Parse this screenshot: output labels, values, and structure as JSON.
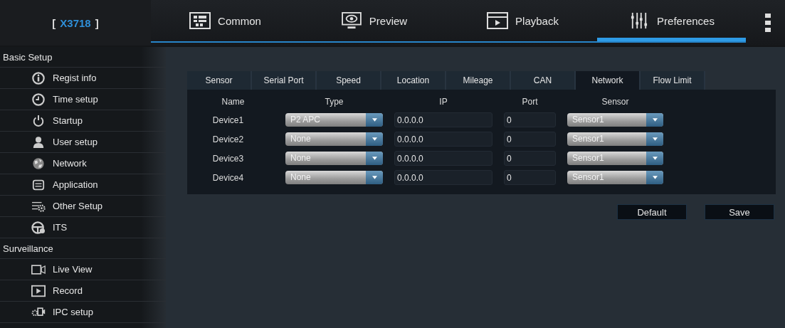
{
  "header": {
    "bracket_open": "[",
    "device": "X3718",
    "bracket_close": "]",
    "nav": [
      {
        "label": "Common",
        "selected": false
      },
      {
        "label": "Preview",
        "selected": false
      },
      {
        "label": "Playback",
        "selected": false
      },
      {
        "label": "Preferences",
        "selected": true
      }
    ]
  },
  "sidebar": [
    {
      "kind": "section",
      "label": "Basic Setup"
    },
    {
      "kind": "item",
      "label": "Regist info"
    },
    {
      "kind": "item",
      "label": "Time setup"
    },
    {
      "kind": "item",
      "label": "Startup"
    },
    {
      "kind": "item",
      "label": "User setup"
    },
    {
      "kind": "item",
      "label": "Network"
    },
    {
      "kind": "item",
      "label": "Application"
    },
    {
      "kind": "item",
      "label": "Other Setup"
    },
    {
      "kind": "item",
      "label": "ITS"
    },
    {
      "kind": "section",
      "label": "Surveillance"
    },
    {
      "kind": "item",
      "label": "Live View"
    },
    {
      "kind": "item",
      "label": "Record"
    },
    {
      "kind": "item",
      "label": "IPC setup"
    }
  ],
  "tabs": [
    {
      "label": "Sensor",
      "selected": false
    },
    {
      "label": "Serial Port",
      "selected": false
    },
    {
      "label": "Speed",
      "selected": false
    },
    {
      "label": "Location",
      "selected": false
    },
    {
      "label": "Mileage",
      "selected": false
    },
    {
      "label": "CAN",
      "selected": false
    },
    {
      "label": "Network",
      "selected": true
    },
    {
      "label": "Flow Limit",
      "selected": false
    }
  ],
  "table": {
    "columns": [
      "Name",
      "Type",
      "IP",
      "Port",
      "Sensor"
    ],
    "rows": [
      {
        "name": "Device1",
        "type": "P2 APC",
        "ip": "0.0.0.0",
        "port": "0",
        "sensor": "Sensor1"
      },
      {
        "name": "Device2",
        "type": "None",
        "ip": "0.0.0.0",
        "port": "0",
        "sensor": "Sensor1"
      },
      {
        "name": "Device3",
        "type": "None",
        "ip": "0.0.0.0",
        "port": "0",
        "sensor": "Sensor1"
      },
      {
        "name": "Device4",
        "type": "None",
        "ip": "0.0.0.0",
        "port": "0",
        "sensor": "Sensor1"
      }
    ]
  },
  "buttons": [
    "Default",
    "Save"
  ]
}
